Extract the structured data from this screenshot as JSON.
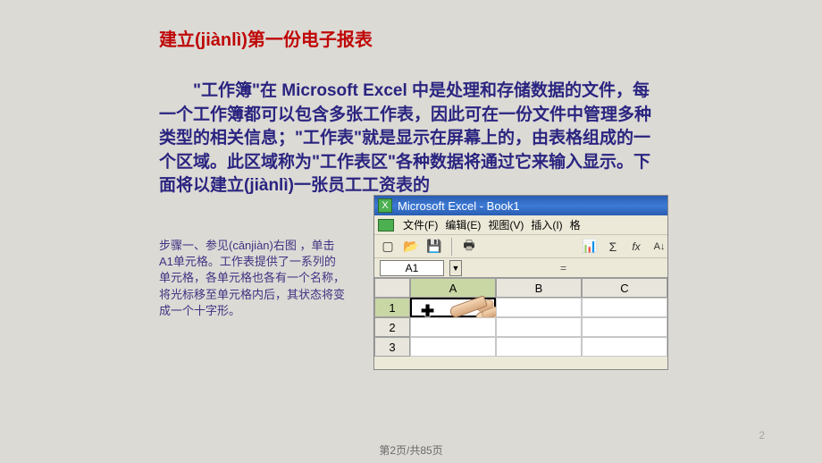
{
  "title": "建立(jiànlì)第一份电子报表",
  "body": "　　\"工作簿\"在 Microsoft Excel 中是处理和存储数据的文件，每一个工作簿都可以包含多张工作表，因此可在一份文件中管理多种类型的相关信息；\"工作表\"就是显示在屏幕上的，由表格组成的一个区域。此区域称为\"工作表区\"各种数据将通过它来输入显示。下面将以建立(jiànlì)一张员工工资表的",
  "step": "步骤一、参见(cānjiàn)右图 ，单击A1单元格。工作表提供了一系列的单元格，各单元格也各有一个名称，将光标移至单元格内后，其状态将变成一个十字形。",
  "excel": {
    "titlebar": "Microsoft Excel - Book1",
    "menu": {
      "file": "文件(F)",
      "edit": "编辑(E)",
      "view": "视图(V)",
      "insert": "插入(I)",
      "format": "格"
    },
    "namebox": "A1",
    "cols": {
      "A": "A",
      "B": "B",
      "C": "C"
    },
    "rows": {
      "r1": "1",
      "r2": "2",
      "r3": "3"
    },
    "eq": "="
  },
  "footer": "第2页/共85页",
  "pagenum": "2"
}
